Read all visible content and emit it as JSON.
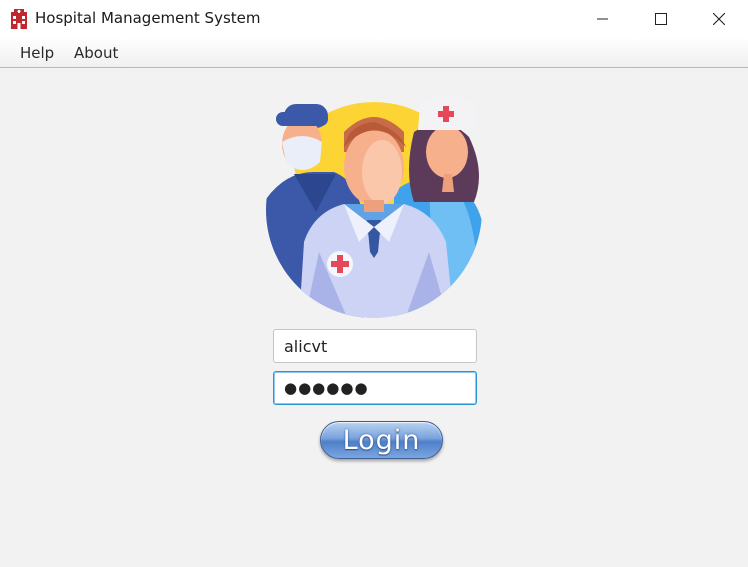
{
  "window": {
    "title": "Hospital Management System",
    "icon": "hospital-building-icon",
    "controls": [
      "minimize-icon",
      "maximize-icon",
      "close-icon"
    ]
  },
  "menubar": {
    "items": [
      {
        "label": "Help"
      },
      {
        "label": "About"
      }
    ]
  },
  "login": {
    "username_value": "alicvt",
    "password_masked": "●●●●●●",
    "button_label": "Login"
  },
  "colors": {
    "accent_focus": "#2b95d6",
    "brand_red": "#c0282d",
    "button_blue": "#5b88cf"
  }
}
